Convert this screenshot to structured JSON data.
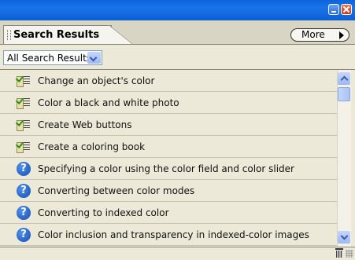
{
  "panel": {
    "tab_label": "Search Results",
    "more_label": "More",
    "dropdown_value": "All Search Results"
  },
  "results": [
    {
      "type": "task",
      "icon": "task-icon",
      "label": "Change an object's color"
    },
    {
      "type": "task",
      "icon": "task-icon",
      "label": "Color a black and white photo"
    },
    {
      "type": "task",
      "icon": "task-icon",
      "label": "Create Web buttons"
    },
    {
      "type": "task",
      "icon": "task-icon",
      "label": "Create a coloring book"
    },
    {
      "type": "help",
      "icon": "help-icon",
      "label": "Specifying a color using the color field and color slider"
    },
    {
      "type": "help",
      "icon": "help-icon",
      "label": "Converting between color modes"
    },
    {
      "type": "help",
      "icon": "help-icon",
      "label": "Converting to indexed color"
    },
    {
      "type": "help",
      "icon": "help-icon",
      "label": "Color inclusion and transparency in indexed-color images"
    }
  ],
  "colors": {
    "titlebar": "#0b5fd6",
    "panel_bg": "#ece9d8",
    "help_icon": "#154fb5",
    "check": "#2f8d1b"
  }
}
